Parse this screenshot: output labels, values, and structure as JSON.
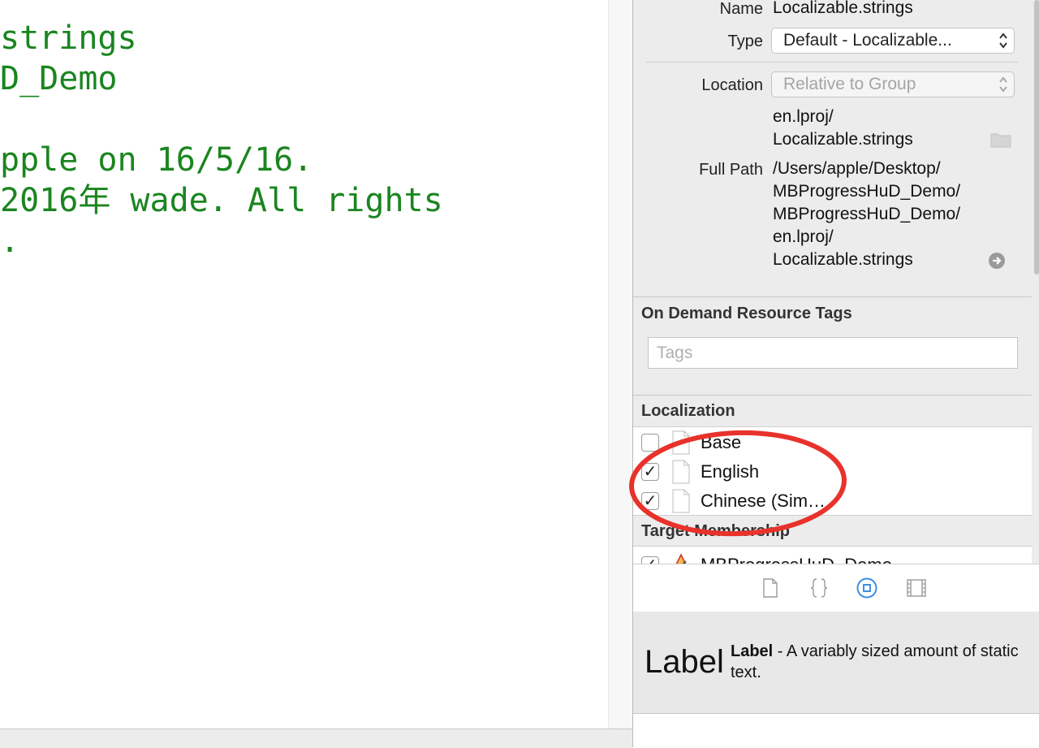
{
  "editor": {
    "lines": [
      "strings",
      "D_Demo",
      "",
      "pple on 16/5/16.",
      "2016年 wade. All rights",
      "."
    ]
  },
  "inspector": {
    "identity": {
      "name_label": "Name",
      "name_value": "Localizable.strings",
      "type_label": "Type",
      "type_value": "Default - Localizable...",
      "location_label": "Location",
      "location_value": "Relative to Group",
      "location_path": [
        "en.lproj/",
        "Localizable.strings"
      ],
      "fullpath_label": "Full Path",
      "fullpath_value": [
        "/Users/apple/Desktop/",
        "MBProgressHuD_Demo/",
        "MBProgressHuD_Demo/",
        "en.lproj/",
        "Localizable.strings"
      ]
    },
    "odr": {
      "title": "On Demand Resource Tags",
      "placeholder": "Tags"
    },
    "localization": {
      "title": "Localization",
      "items": [
        {
          "label": "Base",
          "checked": false
        },
        {
          "label": "English",
          "checked": true
        },
        {
          "label": "Chinese (Sim…",
          "checked": true
        }
      ]
    },
    "target_membership": {
      "title": "Target Membership",
      "items": [
        {
          "label": "MBProgressHuD_Demo",
          "checked": true
        }
      ]
    },
    "library_tabs": [
      "file-template-icon",
      "code-snippet-icon",
      "object-library-icon",
      "media-library-icon"
    ],
    "library_item": {
      "preview": "Label",
      "name": "Label",
      "description": " - A variably sized amount of static text."
    }
  },
  "colors": {
    "code_green": "#1a851f",
    "annotation_red": "#e8322b",
    "selected_tab_blue": "#3d8fe0"
  }
}
